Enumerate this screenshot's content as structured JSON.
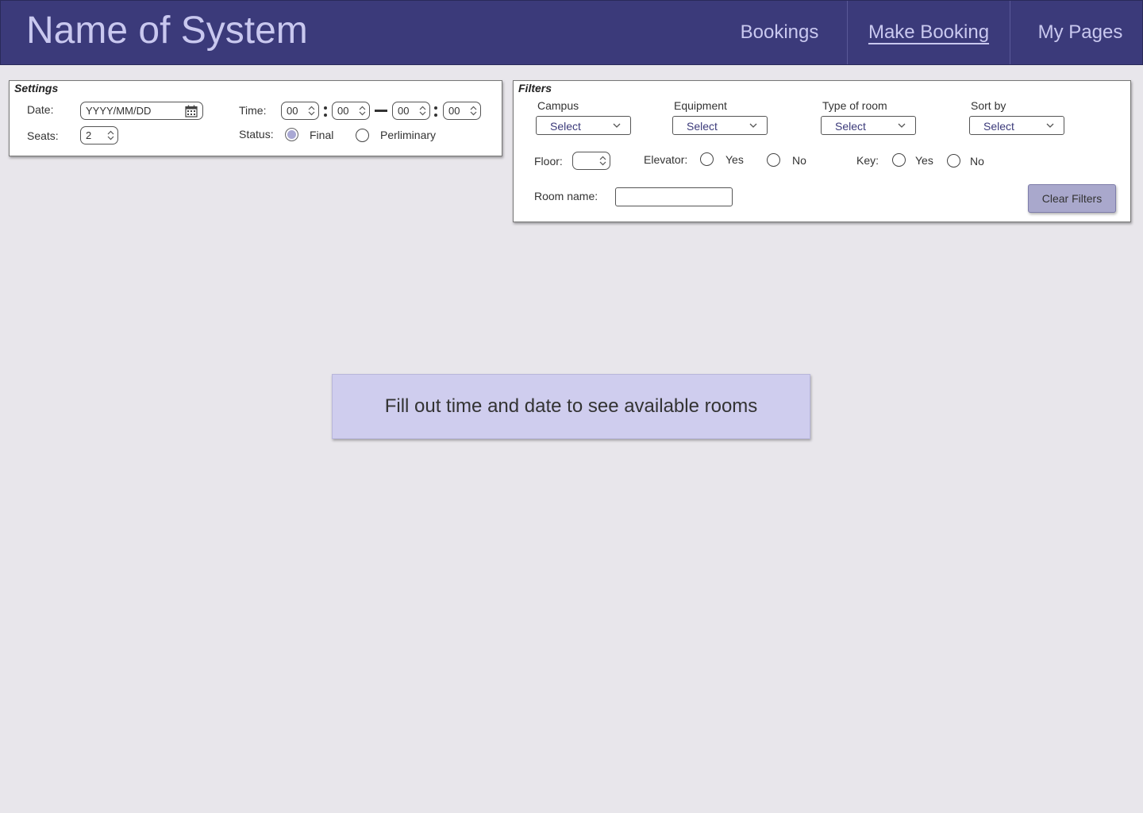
{
  "header": {
    "title": "Name of System",
    "nav": {
      "bookings": "Bookings",
      "make_booking": "Make Booking",
      "my_pages": "My Pages"
    },
    "active_nav": "Make Booking"
  },
  "settings": {
    "title": "Settings",
    "date_label": "Date:",
    "date_placeholder": "YYYY/MM/DD",
    "seats_label": "Seats:",
    "seats_value": "2",
    "time_label": "Time:",
    "time": {
      "start_hour": "00",
      "start_minute": "00",
      "end_hour": "00",
      "end_minute": "00"
    },
    "status_label": "Status:",
    "status_options": [
      "Final",
      "Perliminary"
    ],
    "status_selected": "Final"
  },
  "filters": {
    "title": "Filters",
    "campus_label": "Campus",
    "equipment_label": "Equipment",
    "room_type_label": "Type of room",
    "sort_label": "Sort by",
    "select_placeholder": "Select",
    "floor_label": "Floor:",
    "floor_value": "",
    "elevator_label": "Elevator:",
    "key_label": "Key:",
    "yes_label": "Yes",
    "no_label": "No",
    "room_name_label": "Room name:",
    "room_name_value": "",
    "clear_button": "Clear Filters"
  },
  "message": "Fill out time and date to see available rooms",
  "colors": {
    "header_bg": "#3b3a7a",
    "header_text": "#c9c8ef",
    "accent": "#a9a8cc",
    "message_bg": "#cfcdee"
  }
}
